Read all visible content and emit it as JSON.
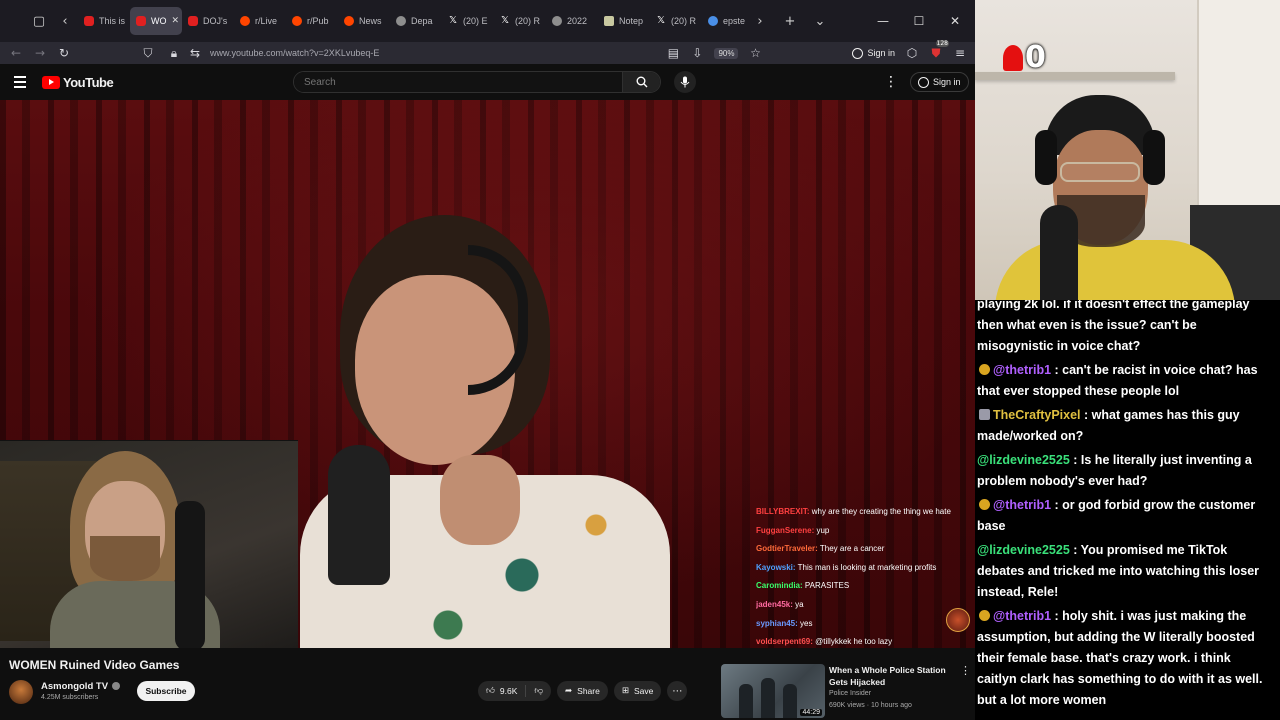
{
  "browser": {
    "tabs": [
      {
        "label": "This is",
        "icon": "youtube-icon",
        "active": false
      },
      {
        "label": "WO",
        "icon": "youtube-icon",
        "active": true
      },
      {
        "label": "DOJ's",
        "icon": "youtube-icon",
        "active": false
      },
      {
        "label": "r/Live",
        "icon": "reddit-icon",
        "active": false
      },
      {
        "label": "r/Pub",
        "icon": "reddit-icon",
        "active": false
      },
      {
        "label": "News",
        "icon": "reddit-icon",
        "active": false
      },
      {
        "label": "Depa",
        "icon": "page-icon",
        "active": false
      },
      {
        "label": "(20) E",
        "icon": "x-icon",
        "active": false
      },
      {
        "label": "(20) R",
        "icon": "x-icon",
        "active": false
      },
      {
        "label": "2022",
        "icon": "blank-icon",
        "active": false
      },
      {
        "label": "Notep",
        "icon": "note-icon",
        "active": false
      },
      {
        "label": "(20) R",
        "icon": "x-icon",
        "active": false
      },
      {
        "label": "epste",
        "icon": "google-icon",
        "active": false
      }
    ],
    "url": "www.youtube.com/watch?v=2XKLvubeq-E",
    "zoom": "90%",
    "sign_in": "Sign in",
    "extensions_badge": "128"
  },
  "youtube": {
    "logo_text": "YouTube",
    "search_placeholder": "Search",
    "sign_in": "Sign in"
  },
  "video_chat": [
    {
      "user": "BILLYBREXIT:",
      "color": "#ff4040",
      "text": "why are they creating the thing we hate"
    },
    {
      "user": "FugganSerene:",
      "color": "#ff4040",
      "text": "yup"
    },
    {
      "user": "GodtierTraveler:",
      "color": "#ff6a3a",
      "text": "They are a cancer"
    },
    {
      "user": "Kayowski:",
      "color": "#4fa0ff",
      "text": "This man is looking at marketing profits"
    },
    {
      "user": "Caromindia:",
      "color": "#3aff6a",
      "text": "PARASITES"
    },
    {
      "user": "jaden45k:",
      "color": "#ff6aa0",
      "text": "ya"
    },
    {
      "user": "syphian45:",
      "color": "#6a9aff",
      "text": "yes"
    },
    {
      "user": "voldserpent69:",
      "color": "#ff5050",
      "text": "@tillykkek he too lazy"
    }
  ],
  "video": {
    "title": "WOMEN Ruined Video Games",
    "channel": "Asmongold TV",
    "subscribers": "4.25M subscribers",
    "subscribe_label": "Subscribe",
    "likes": "9.6K",
    "share_label": "Share",
    "save_label": "Save"
  },
  "recommended": {
    "title": "When a Whole Police Station Gets Hijacked",
    "channel": "Police Insider",
    "meta": "690K views · 10 hours ago",
    "duration": "44:29"
  },
  "overlay": {
    "counter": "0"
  },
  "chat": [
    {
      "badge": "",
      "user": "",
      "color": "#ffffff",
      "text": "playing 2k lol. if it doesn't effect the gameplay then what even is the issue? can't be misogynistic in voice chat?"
    },
    {
      "badge": "gold",
      "user": "@thetrib1",
      "color": "#b060ff",
      "text": " : can't be racist in voice chat? has that ever stopped these people lol"
    },
    {
      "badge": "gray",
      "user": "TheCraftyPixel",
      "color": "#e0c040",
      "text": " : what games has this guy made/worked on?"
    },
    {
      "badge": "",
      "user": "@lizdevine2525",
      "color": "#3ae07a",
      "text": " : Is he literally just inventing a problem nobody's ever had?"
    },
    {
      "badge": "gold",
      "user": "@thetrib1",
      "color": "#b060ff",
      "text": " : or god forbid grow the customer base"
    },
    {
      "badge": "",
      "user": "@lizdevine2525",
      "color": "#3ae07a",
      "text": " : You promised me TikTok debates and tricked me into watching this loser instead, Rele!"
    },
    {
      "badge": "gold",
      "user": "@thetrib1",
      "color": "#b060ff",
      "text": " : holy shit. i was just making the assumption, but adding the W literally boosted their female base. that's crazy work. i think caitlyn clark has something to do with it as well. but a lot more women"
    }
  ]
}
